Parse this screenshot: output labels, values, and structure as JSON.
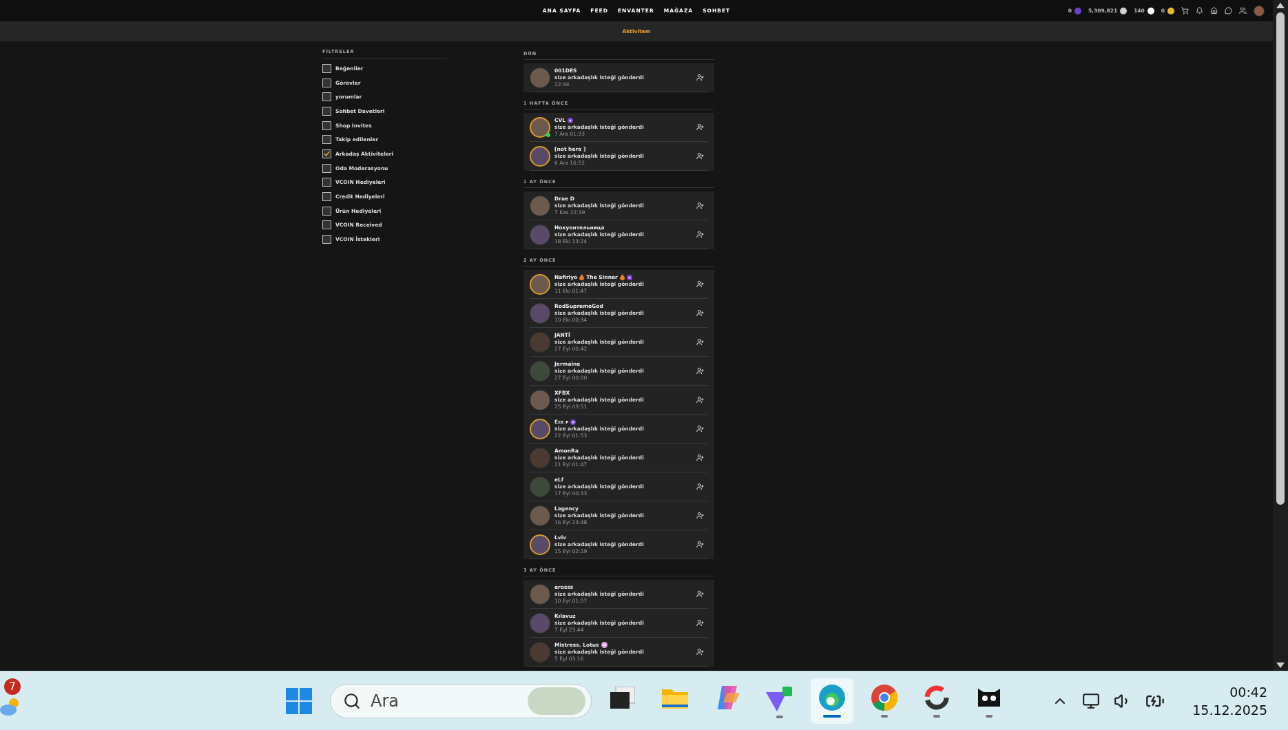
{
  "top_nav": {
    "links": [
      {
        "label": "ANA SAYFA"
      },
      {
        "label": "FEED"
      },
      {
        "label": "ENVANTER"
      },
      {
        "label": "MAĞAZA"
      },
      {
        "label": "SOHBET"
      }
    ],
    "wallet": [
      {
        "kind": "gem",
        "amount": "0"
      },
      {
        "kind": "credit",
        "amount": "5,309,821"
      },
      {
        "kind": "vcoin",
        "amount": "140"
      },
      {
        "kind": "token",
        "amount": "0"
      }
    ]
  },
  "sub_header": {
    "title": "Aktivitem"
  },
  "filters": {
    "title": "FİLTRELER",
    "items": [
      {
        "label": "Beğeniler",
        "checked": false
      },
      {
        "label": "Görevler",
        "checked": false
      },
      {
        "label": "yorumlar",
        "checked": false
      },
      {
        "label": "Sohbet Davetleri",
        "checked": false
      },
      {
        "label": "Shop Invites",
        "checked": false
      },
      {
        "label": "Takip edilenler",
        "checked": false
      },
      {
        "label": "Arkadaş Aktiviteleri",
        "checked": true
      },
      {
        "label": "Oda Moderasyonu",
        "checked": false
      },
      {
        "label": "VCOIN Hediyeleri",
        "checked": false
      },
      {
        "label": "Credit Hediyeleri",
        "checked": false
      },
      {
        "label": "Ürün Hediyeleri",
        "checked": false
      },
      {
        "label": "VCOIN Received",
        "checked": false
      },
      {
        "label": "VCOIN İstekleri",
        "checked": false
      }
    ]
  },
  "feed": [
    {
      "heading": "DÜN",
      "items": [
        {
          "name": [
            {
              "kind": "text",
              "text": "001DES"
            }
          ],
          "message": "size arkadaşlık isteği gönderdi",
          "time": "22:44",
          "ring": false,
          "online": false
        }
      ]
    },
    {
      "heading": "1 HAFTA ÖNCE",
      "items": [
        {
          "name": [
            {
              "kind": "text",
              "text": "CVL"
            },
            {
              "kind": "vip"
            }
          ],
          "message": "size arkadaşlık isteği gönderdi",
          "time": "7 Ara 01:33",
          "ring": true,
          "online": true
        },
        {
          "name": [
            {
              "kind": "text",
              "text": "[not here ]"
            }
          ],
          "message": "size arkadaşlık isteği gönderdi",
          "time": "6 Ara 16:52",
          "ring": true,
          "online": false
        }
      ]
    },
    {
      "heading": "1 AY ÖNCE",
      "items": [
        {
          "name": [
            {
              "kind": "text",
              "text": "Drae D"
            }
          ],
          "message": "size arkadaşlık isteği gönderdi",
          "time": "7 Kas 22:39",
          "ring": false,
          "online": false
        },
        {
          "name": [
            {
              "kind": "text",
              "text": "Нокуонтельница"
            }
          ],
          "message": "size arkadaşlık isteği gönderdi",
          "time": "18 Eki 13:24",
          "ring": false,
          "online": false
        }
      ]
    },
    {
      "heading": "2 AY ÖNCE",
      "items": [
        {
          "name": [
            {
              "kind": "text",
              "text": "Nafiriyo"
            },
            {
              "kind": "flame"
            },
            {
              "kind": "text",
              "text": "The Sinner"
            },
            {
              "kind": "flame"
            },
            {
              "kind": "vip"
            }
          ],
          "message": "size arkadaşlık isteği gönderdi",
          "time": "11 Eki 01:47",
          "ring": true,
          "online": false
        },
        {
          "name": [
            {
              "kind": "text",
              "text": "RodSupremeGod"
            }
          ],
          "message": "size arkadaşlık isteği gönderdi",
          "time": "10 Eki 00:34",
          "ring": false,
          "online": false
        },
        {
          "name": [
            {
              "kind": "text",
              "text": "JANTİ"
            }
          ],
          "message": "size arkadaşlık isteği gönderdi",
          "time": "27 Eyl 00:42",
          "ring": false,
          "online": false
        },
        {
          "name": [
            {
              "kind": "text",
              "text": "Jermaine"
            }
          ],
          "message": "size arkadaşlık isteği gönderdi",
          "time": "27 Eyl 00:00",
          "ring": false,
          "online": false
        },
        {
          "name": [
            {
              "kind": "text",
              "text": "XFBX"
            }
          ],
          "message": "size arkadaşlık isteği gönderdi",
          "time": "25 Eyl 03:51",
          "ring": false,
          "online": false
        },
        {
          "name": [
            {
              "kind": "text",
              "text": "Ɛᴇᴇ ᴘ"
            },
            {
              "kind": "vip"
            }
          ],
          "message": "size arkadaşlık isteği gönderdi",
          "time": "22 Eyl 01:53",
          "ring": true,
          "online": false
        },
        {
          "name": [
            {
              "kind": "text",
              "text": "AmonRa"
            }
          ],
          "message": "size arkadaşlık isteği gönderdi",
          "time": "21 Eyl 01:47",
          "ring": false,
          "online": false
        },
        {
          "name": [
            {
              "kind": "text",
              "text": "eLf"
            }
          ],
          "message": "size arkadaşlık isteği gönderdi",
          "time": "17 Eyl 00:33",
          "ring": false,
          "online": false
        },
        {
          "name": [
            {
              "kind": "text",
              "text": "Lagency"
            }
          ],
          "message": "size arkadaşlık isteği gönderdi",
          "time": "16 Eyl 23:48",
          "ring": false,
          "online": false
        },
        {
          "name": [
            {
              "kind": "text",
              "text": "Lviv"
            }
          ],
          "message": "size arkadaşlık isteği gönderdi",
          "time": "15 Eyl 02:19",
          "ring": true,
          "online": false
        }
      ]
    },
    {
      "heading": "3 AY ÖNCE",
      "items": [
        {
          "name": [
            {
              "kind": "text",
              "text": "erosss"
            }
          ],
          "message": "size arkadaşlık isteği gönderdi",
          "time": "10 Eyl 01:57",
          "ring": false,
          "online": false
        },
        {
          "name": [
            {
              "kind": "text",
              "text": "Kılavuz"
            }
          ],
          "message": "size arkadaşlık isteği gönderdi",
          "time": "7 Eyl 23:44",
          "ring": false,
          "online": false
        },
        {
          "name": [
            {
              "kind": "text",
              "text": "Mistress. Lotus"
            },
            {
              "kind": "flower"
            }
          ],
          "message": "size arkadaşlık isteği gönderdi",
          "time": "5 Eyl 03:16",
          "ring": false,
          "online": false
        }
      ]
    }
  ],
  "taskbar": {
    "weather_badge": "7",
    "search": {
      "placeholder": "Ara"
    },
    "apps": [
      {
        "kind": "taskview",
        "running": false,
        "selected": false
      },
      {
        "kind": "folder",
        "running": false,
        "selected": false
      },
      {
        "kind": "copilot",
        "running": false,
        "selected": false
      },
      {
        "kind": "vpn",
        "running": true,
        "selected": false
      },
      {
        "kind": "edge",
        "running": true,
        "selected": true
      },
      {
        "kind": "chrome",
        "running": true,
        "selected": false
      },
      {
        "kind": "ring",
        "running": true,
        "selected": false
      },
      {
        "kind": "imvu",
        "running": true,
        "selected": false
      }
    ],
    "time": "00:42",
    "date": "15.12.2025"
  }
}
